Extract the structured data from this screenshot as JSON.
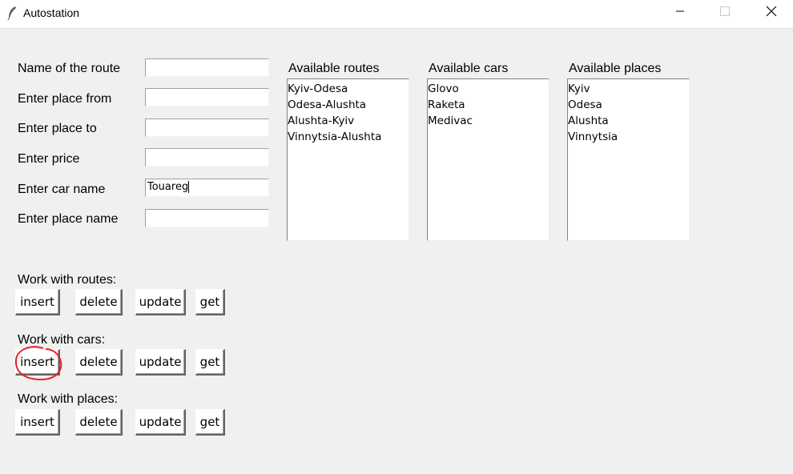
{
  "window": {
    "title": "Autostation"
  },
  "form": {
    "fields": [
      {
        "label": "Name of the route",
        "value": ""
      },
      {
        "label": "Enter place from",
        "value": ""
      },
      {
        "label": "Enter place to",
        "value": ""
      },
      {
        "label": "Enter price",
        "value": ""
      },
      {
        "label": "Enter car name",
        "value": "Touareg"
      },
      {
        "label": "Enter place name",
        "value": ""
      }
    ]
  },
  "lists": {
    "routes": {
      "title": "Available routes",
      "items": [
        "Kyiv-Odesa",
        "Odesa-Alushta",
        "Alushta-Kyiv",
        "Vinnytsia-Alushta"
      ]
    },
    "cars": {
      "title": "Available cars",
      "items": [
        "Glovo",
        "Raketa",
        "Medivac"
      ]
    },
    "places": {
      "title": "Available places",
      "items": [
        "Kyiv",
        "Odesa",
        "Alushta",
        "Vinnytsia"
      ]
    }
  },
  "sections": {
    "routes": {
      "title": "Work with routes:",
      "insert": "insert",
      "delete": "delete",
      "update": "update",
      "get": "get"
    },
    "cars": {
      "title": "Work with cars:",
      "insert": "insert",
      "delete": "delete",
      "update": "update",
      "get": "get"
    },
    "places": {
      "title": "Work with places:",
      "insert": "insert",
      "delete": "delete",
      "update": "update",
      "get": "get"
    }
  },
  "annotation": {
    "color": "#e8202a",
    "target": "cars insert button"
  },
  "icons": {
    "app": "feather-icon",
    "minimize": "minimize-icon",
    "maximize": "maximize-icon",
    "close": "close-icon"
  }
}
